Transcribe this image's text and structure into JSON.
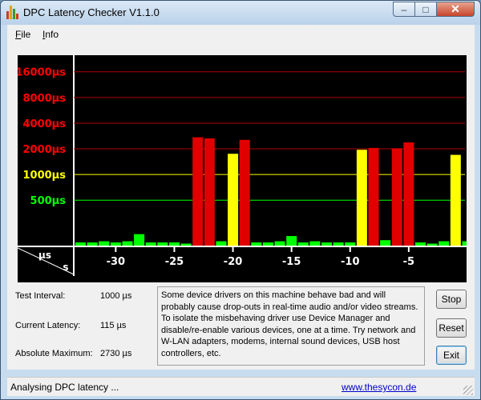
{
  "window": {
    "title": "DPC Latency Checker V1.1.0"
  },
  "titlebar_buttons": {
    "minimize": "–",
    "maximize": "□",
    "close": "✕"
  },
  "icons": {
    "app": "bar-chart-icon",
    "minimize": "minimize-icon",
    "maximize": "maximize-icon",
    "close": "close-icon",
    "grip": "resize-grip-icon"
  },
  "menu": {
    "items": [
      {
        "label": "File",
        "accel": "F"
      },
      {
        "label": "Info",
        "accel": "I"
      }
    ]
  },
  "chart_data": {
    "type": "bar",
    "title": "",
    "y_unit_label": "µs",
    "x_unit_label": "s",
    "y_ticks": [
      {
        "value": 500,
        "label": "500µs",
        "color": "#00ff00"
      },
      {
        "value": 1000,
        "label": "1000µs",
        "color": "#ffff00"
      },
      {
        "value": 2000,
        "label": "2000µs",
        "color": "#ff0000"
      },
      {
        "value": 4000,
        "label": "4000µs",
        "color": "#ff0000"
      },
      {
        "value": 8000,
        "label": "8000µs",
        "color": "#ff0000"
      },
      {
        "value": 16000,
        "label": "16000µs",
        "color": "#ff0000"
      }
    ],
    "x_ticks": [
      -30,
      -25,
      -20,
      -15,
      -10,
      -5
    ],
    "x_range": [
      -33,
      0
    ],
    "y_scale": "log2",
    "y_range": [
      150,
      22000
    ],
    "bar_colors": {
      "green": "#00ff00",
      "yellow": "#ffff00",
      "red": "#e00000"
    },
    "bars": [
      {
        "t": -33,
        "value": 160
      },
      {
        "t": -32,
        "value": 160
      },
      {
        "t": -31,
        "value": 165
      },
      {
        "t": -30,
        "value": 160
      },
      {
        "t": -29,
        "value": 165
      },
      {
        "t": -28,
        "value": 200
      },
      {
        "t": -27,
        "value": 160
      },
      {
        "t": -26,
        "value": 160
      },
      {
        "t": -25,
        "value": 160
      },
      {
        "t": -24,
        "value": 155
      },
      {
        "t": -23,
        "value": 2730
      },
      {
        "t": -22,
        "value": 2650
      },
      {
        "t": -21,
        "value": 165
      },
      {
        "t": -20,
        "value": 1750
      },
      {
        "t": -19,
        "value": 2550
      },
      {
        "t": -18,
        "value": 160
      },
      {
        "t": -17,
        "value": 160
      },
      {
        "t": -16,
        "value": 165
      },
      {
        "t": -15,
        "value": 190
      },
      {
        "t": -14,
        "value": 160
      },
      {
        "t": -13,
        "value": 165
      },
      {
        "t": -12,
        "value": 160
      },
      {
        "t": -11,
        "value": 160
      },
      {
        "t": -10,
        "value": 160
      },
      {
        "t": -9,
        "value": 1950
      },
      {
        "t": -8,
        "value": 2050
      },
      {
        "t": -7,
        "value": 170
      },
      {
        "t": -6,
        "value": 2030
      },
      {
        "t": -5,
        "value": 2380
      },
      {
        "t": -4,
        "value": 160
      },
      {
        "t": -3,
        "value": 155
      },
      {
        "t": -2,
        "value": 165
      },
      {
        "t": -1,
        "value": 1700
      },
      {
        "t": 0,
        "value": 165
      }
    ]
  },
  "info": {
    "test_interval": {
      "label": "Test Interval:",
      "value": "1000 µs"
    },
    "current_latency": {
      "label": "Current Latency:",
      "value": "115 µs"
    },
    "absolute_maximum": {
      "label": "Absolute Maximum:",
      "value": "2730 µs"
    }
  },
  "description": "Some device drivers on this machine behave bad and will probably cause drop-outs in real-time audio and/or video streams. To isolate the misbehaving driver use Device Manager and disable/re-enable various devices, one at a time. Try network and W-LAN adapters, modems, internal sound devices, USB host controllers, etc.",
  "buttons": {
    "stop": "Stop",
    "reset": "Reset",
    "exit": "Exit"
  },
  "status": {
    "text": "Analysing DPC latency ...",
    "link": "www.thesycon.de"
  }
}
